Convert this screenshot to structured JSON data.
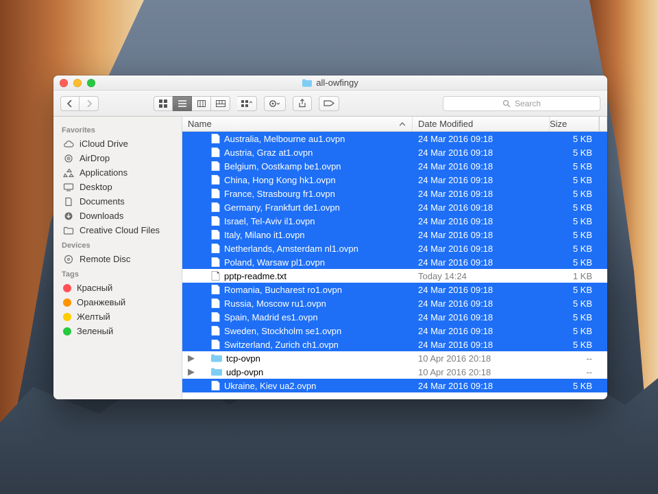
{
  "window": {
    "title": "all-owfingy",
    "search_placeholder": "Search"
  },
  "sidebar": {
    "sections": [
      {
        "title": "Favorites",
        "items": [
          {
            "icon": "cloud",
            "label": "iCloud Drive"
          },
          {
            "icon": "airdrop",
            "label": "AirDrop"
          },
          {
            "icon": "apps",
            "label": "Applications"
          },
          {
            "icon": "desktop",
            "label": "Desktop"
          },
          {
            "icon": "docs",
            "label": "Documents"
          },
          {
            "icon": "downloads",
            "label": "Downloads"
          },
          {
            "icon": "folder",
            "label": "Creative Cloud Files"
          }
        ]
      },
      {
        "title": "Devices",
        "items": [
          {
            "icon": "disc",
            "label": "Remote Disc"
          }
        ]
      },
      {
        "title": "Tags",
        "items": [
          {
            "icon": "tag",
            "color": "#ff5156",
            "label": "Красный"
          },
          {
            "icon": "tag",
            "color": "#ff9500",
            "label": "Оранжевый"
          },
          {
            "icon": "tag",
            "color": "#ffcc00",
            "label": "Желтый"
          },
          {
            "icon": "tag",
            "color": "#27c93f",
            "label": "Зеленый"
          }
        ]
      }
    ]
  },
  "columns": {
    "name": "Name",
    "date": "Date Modified",
    "size": "Size"
  },
  "files": [
    {
      "sel": true,
      "kind": "file",
      "name": "Australia, Melbourne au1.ovpn",
      "date": "24 Mar 2016 09:18",
      "size": "5 KB"
    },
    {
      "sel": true,
      "kind": "file",
      "name": "Austria, Graz at1.ovpn",
      "date": "24 Mar 2016 09:18",
      "size": "5 KB"
    },
    {
      "sel": true,
      "kind": "file",
      "name": "Belgium, Oostkamp be1.ovpn",
      "date": "24 Mar 2016 09:18",
      "size": "5 KB"
    },
    {
      "sel": true,
      "kind": "file",
      "name": "China, Hong Kong hk1.ovpn",
      "date": "24 Mar 2016 09:18",
      "size": "5 KB"
    },
    {
      "sel": true,
      "kind": "file",
      "name": "France, Strasbourg fr1.ovpn",
      "date": "24 Mar 2016 09:18",
      "size": "5 KB"
    },
    {
      "sel": true,
      "kind": "file",
      "name": "Germany, Frankfurt de1.ovpn",
      "date": "24 Mar 2016 09:18",
      "size": "5 KB"
    },
    {
      "sel": true,
      "kind": "file",
      "name": "Israel, Tel-Aviv il1.ovpn",
      "date": "24 Mar 2016 09:18",
      "size": "5 KB"
    },
    {
      "sel": true,
      "kind": "file",
      "name": "Italy, Milano it1.ovpn",
      "date": "24 Mar 2016 09:18",
      "size": "5 KB"
    },
    {
      "sel": true,
      "kind": "file",
      "name": "Netherlands, Amsterdam nl1.ovpn",
      "date": "24 Mar 2016 09:18",
      "size": "5 KB"
    },
    {
      "sel": true,
      "kind": "file",
      "name": "Poland, Warsaw pl1.ovpn",
      "date": "24 Mar 2016 09:18",
      "size": "5 KB"
    },
    {
      "sel": false,
      "kind": "txt",
      "name": "pptp-readme.txt",
      "date": "Today 14:24",
      "size": "1 KB"
    },
    {
      "sel": true,
      "kind": "file",
      "name": "Romania, Bucharest ro1.ovpn",
      "date": "24 Mar 2016 09:18",
      "size": "5 KB"
    },
    {
      "sel": true,
      "kind": "file",
      "name": "Russia, Moscow ru1.ovpn",
      "date": "24 Mar 2016 09:18",
      "size": "5 KB"
    },
    {
      "sel": true,
      "kind": "file",
      "name": "Spain, Madrid es1.ovpn",
      "date": "24 Mar 2016 09:18",
      "size": "5 KB"
    },
    {
      "sel": true,
      "kind": "file",
      "name": "Sweden, Stockholm se1.ovpn",
      "date": "24 Mar 2016 09:18",
      "size": "5 KB"
    },
    {
      "sel": true,
      "kind": "file",
      "name": "Switzerland, Zurich ch1.ovpn",
      "date": "24 Mar 2016 09:18",
      "size": "5 KB"
    },
    {
      "sel": false,
      "kind": "folder",
      "name": "tcp-ovpn",
      "date": "10 Apr 2016 20:18",
      "size": "--"
    },
    {
      "sel": false,
      "kind": "folder",
      "name": "udp-ovpn",
      "date": "10 Apr 2016 20:18",
      "size": "--"
    },
    {
      "sel": true,
      "kind": "file",
      "name": "Ukraine, Kiev ua2.ovpn",
      "date": "24 Mar 2016 09:18",
      "size": "5 KB"
    }
  ]
}
